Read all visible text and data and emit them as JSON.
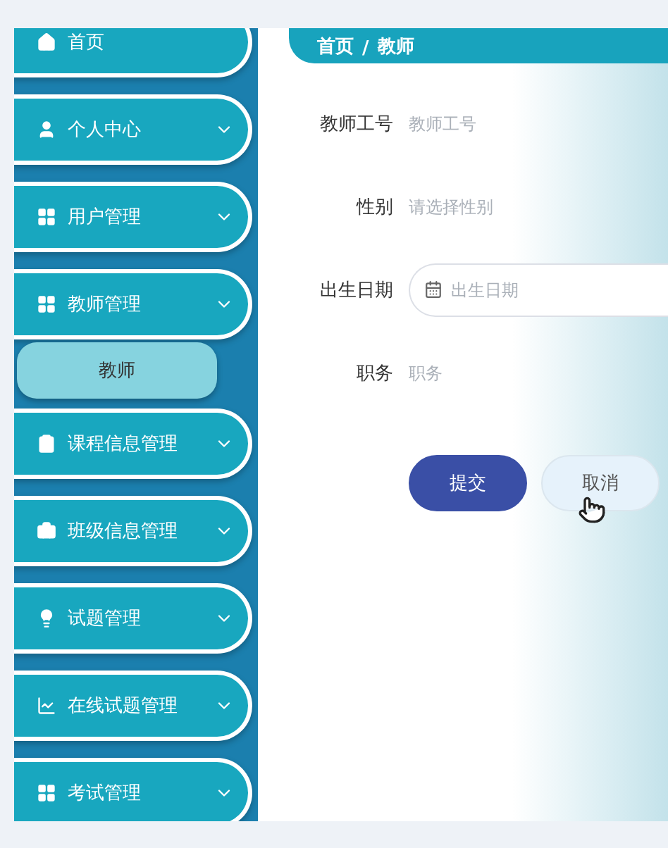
{
  "sidebar": {
    "items": [
      {
        "label": "首页",
        "expandable": false
      },
      {
        "label": "个人中心",
        "expandable": true
      },
      {
        "label": "用户管理",
        "expandable": true
      },
      {
        "label": "教师管理",
        "expandable": true,
        "children": [
          {
            "label": "教师",
            "selected": true
          }
        ]
      },
      {
        "label": "课程信息管理",
        "expandable": true
      },
      {
        "label": "班级信息管理",
        "expandable": true
      },
      {
        "label": "试题管理",
        "expandable": true
      },
      {
        "label": "在线试题管理",
        "expandable": true
      },
      {
        "label": "考试管理",
        "expandable": true
      }
    ]
  },
  "breadcrumb": {
    "items": [
      "首页",
      "教师"
    ],
    "separator": "/"
  },
  "form": {
    "fields": [
      {
        "kind": "input",
        "label": "教师工号",
        "placeholder": "教师工号"
      },
      {
        "kind": "select",
        "label": "性别",
        "placeholder": "请选择性别"
      },
      {
        "kind": "date",
        "label": "出生日期",
        "placeholder": "出生日期"
      },
      {
        "kind": "input",
        "label": "职务",
        "placeholder": "职务"
      }
    ],
    "buttons": [
      {
        "kind": "primary",
        "label": "提交"
      },
      {
        "kind": "secondary",
        "label": "取消",
        "hovered": true
      }
    ]
  }
}
